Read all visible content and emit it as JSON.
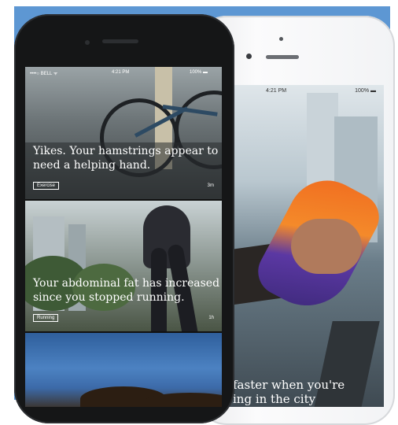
{
  "front_phone": {
    "status": {
      "carrier": "••••○ BELL ᯤ",
      "time": "4:21 PM",
      "battery": "100% ▬"
    },
    "cards": [
      {
        "title_lines": [
          "Yikes. Your hamstrings appear to",
          "need a helping hand."
        ],
        "tag": "Exercise",
        "meta": "3m"
      },
      {
        "title_lines": [
          "Your abdominal fat has increased",
          "since you stopped running."
        ],
        "tag": "Running",
        "meta": "1h"
      },
      {
        "title_lines": [],
        "tag": "",
        "meta": ""
      }
    ]
  },
  "back_phone": {
    "status": {
      "time": "4:21 PM",
      "battery": "100% ▬"
    },
    "caption_lines": [
      "faster when you're",
      "ing in the city"
    ]
  },
  "colors": {
    "background": "#5d97d3",
    "front_phone": "#151617",
    "back_phone": "#f2f3f5"
  }
}
